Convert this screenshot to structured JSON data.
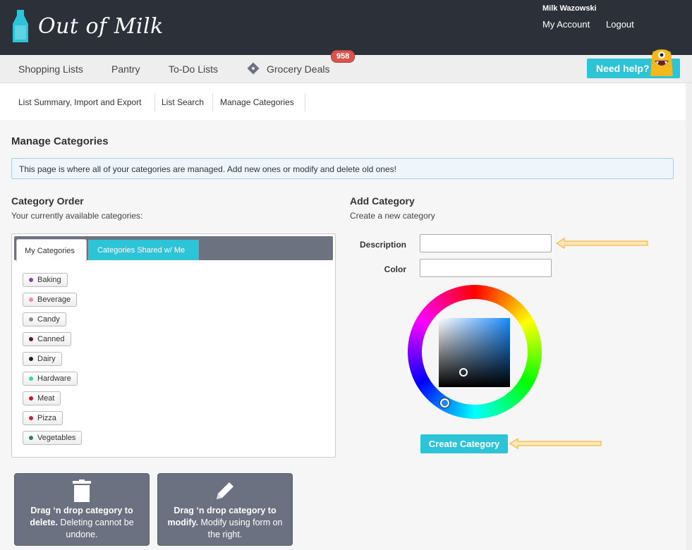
{
  "header": {
    "logo_text": "Out of Milk",
    "user_name": "Milk Wazowski",
    "my_account": "My Account",
    "logout": "Logout"
  },
  "nav": {
    "shopping_lists": "Shopping Lists",
    "pantry": "Pantry",
    "todo_lists": "To-Do Lists",
    "grocery_deals": "Grocery Deals",
    "deals_badge": "958",
    "need_help": "Need help?"
  },
  "subnav": {
    "summary": "List Summary, Import and Export",
    "search": "List Search",
    "manage": "Manage Categories"
  },
  "page": {
    "title": "Manage Categories",
    "info": "This page is where all of your categories are managed. Add new ones or modify and delete old ones!"
  },
  "category_order": {
    "title": "Category Order",
    "subtitle": "Your currently available categories:",
    "tab_mine": "My Categories",
    "tab_shared": "Categories Shared w/ Me",
    "items": [
      {
        "label": "Baking",
        "color": "#8e3f9e"
      },
      {
        "label": "Beverage",
        "color": "#f08b9a"
      },
      {
        "label": "Candy",
        "color": "#8a8a8a"
      },
      {
        "label": "Canned",
        "color": "#5a1a3a"
      },
      {
        "label": "Dairy",
        "color": "#222222"
      },
      {
        "label": "Hardware",
        "color": "#3cd6a0"
      },
      {
        "label": "Meat",
        "color": "#d0152a"
      },
      {
        "label": "Pizza",
        "color": "#c4263a"
      },
      {
        "label": "Vegetables",
        "color": "#2e7a78"
      }
    ]
  },
  "dropzones": {
    "delete_bold": "Drag ‘n drop category to delete.",
    "delete_rest": " Deleting cannot be undone.",
    "modify_bold": "Drag ‘n drop category to modify.",
    "modify_rest": " Modify using form on the right."
  },
  "add_category": {
    "title": "Add Category",
    "subtitle": "Create a new category",
    "description_label": "Description",
    "description_value": "",
    "color_label": "Color",
    "color_value": "",
    "create_button": "Create Category"
  },
  "colors": {
    "accent": "#2ec4d8",
    "header_bg": "#2c3139",
    "badge": "#d9534f",
    "arrow": "#f5b946"
  }
}
